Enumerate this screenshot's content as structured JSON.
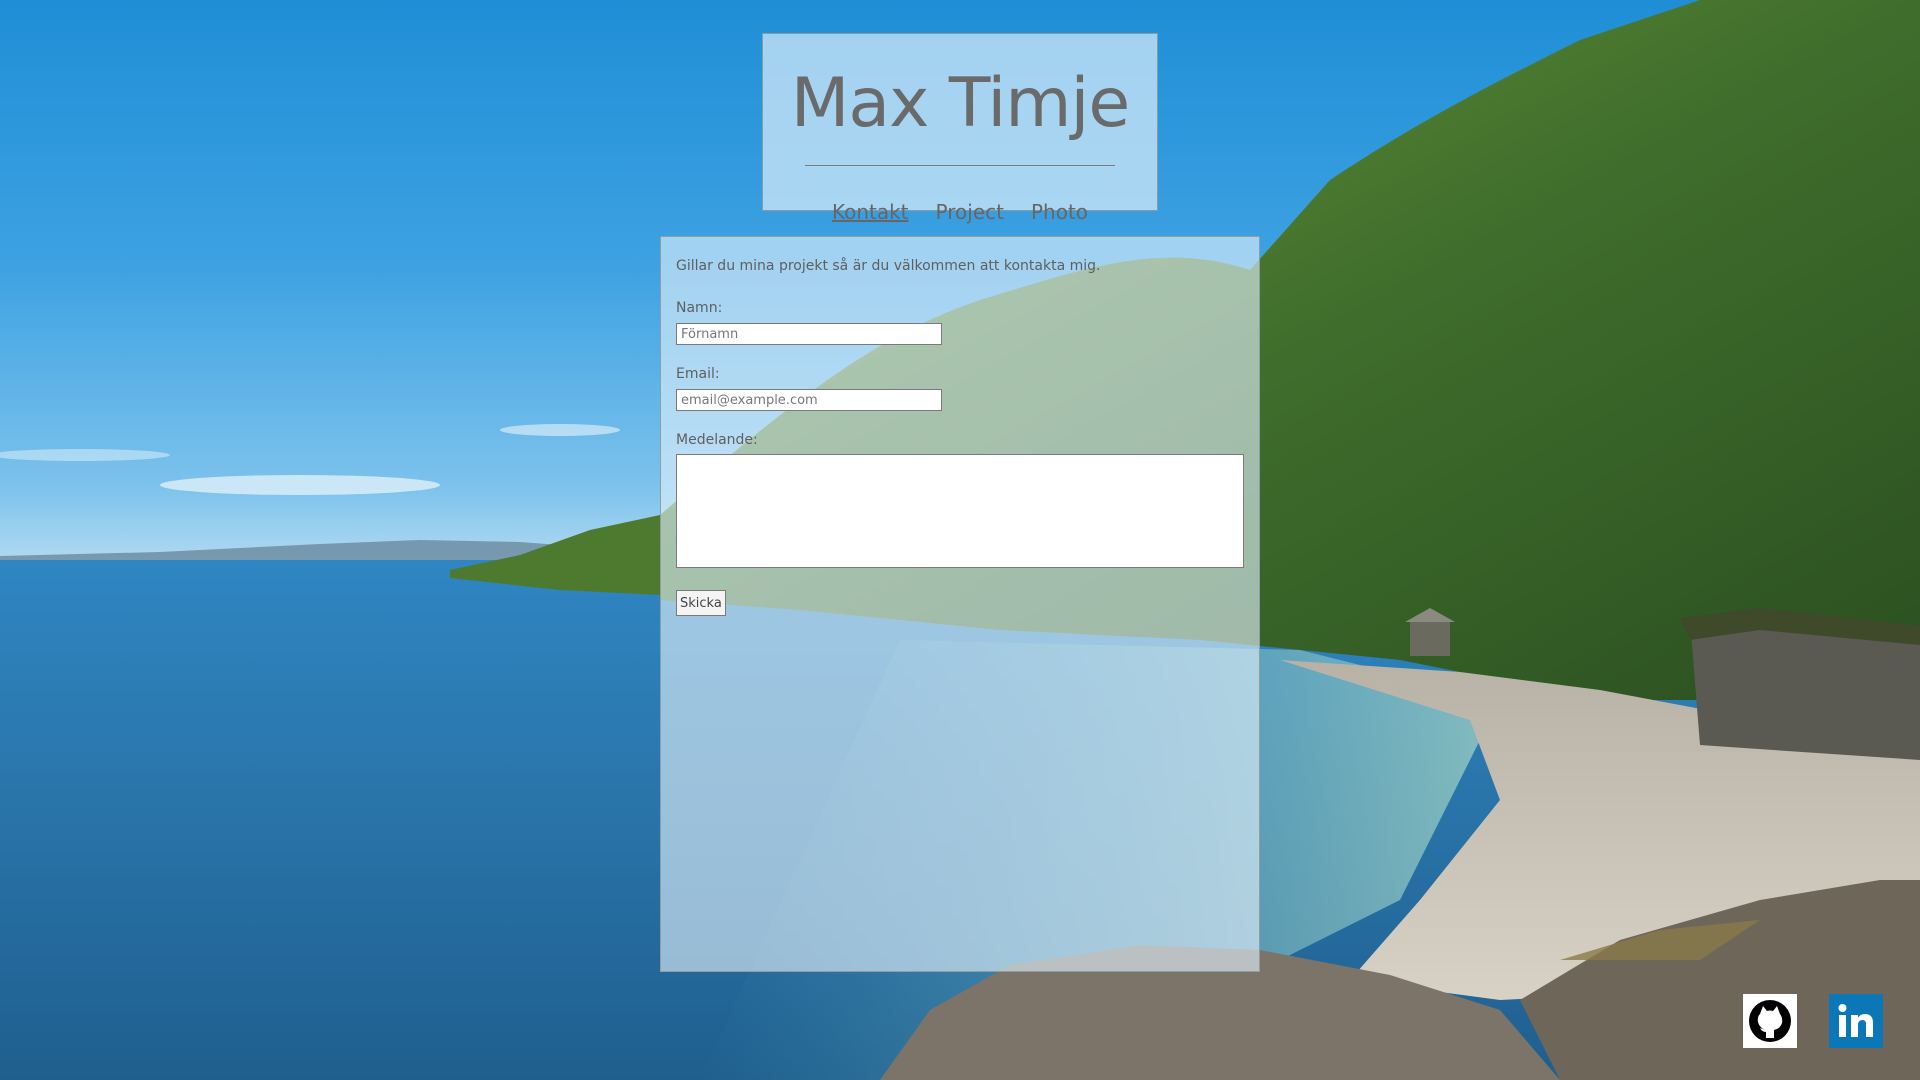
{
  "header": {
    "title": "Max Timje",
    "nav": [
      {
        "label": "Kontakt",
        "active": true
      },
      {
        "label": "Project",
        "active": false
      },
      {
        "label": "Photo",
        "active": false
      }
    ]
  },
  "contact": {
    "intro": "Gillar du mina projekt så är du välkommen att kontakta mig.",
    "name_label": "Namn:",
    "name_placeholder": "Förnamn",
    "email_label": "Email:",
    "email_placeholder": "email@example.com",
    "message_label": "Medelande:",
    "submit_label": "Skicka"
  },
  "social": [
    {
      "icon": "github-icon",
      "color": "#000000"
    },
    {
      "icon": "linkedin-icon",
      "color": "#0b77b7"
    }
  ],
  "colors": {
    "sky": "#2f9be0",
    "water": "#2f78b0",
    "forest": "#3f6e2c",
    "text": "#666666"
  }
}
